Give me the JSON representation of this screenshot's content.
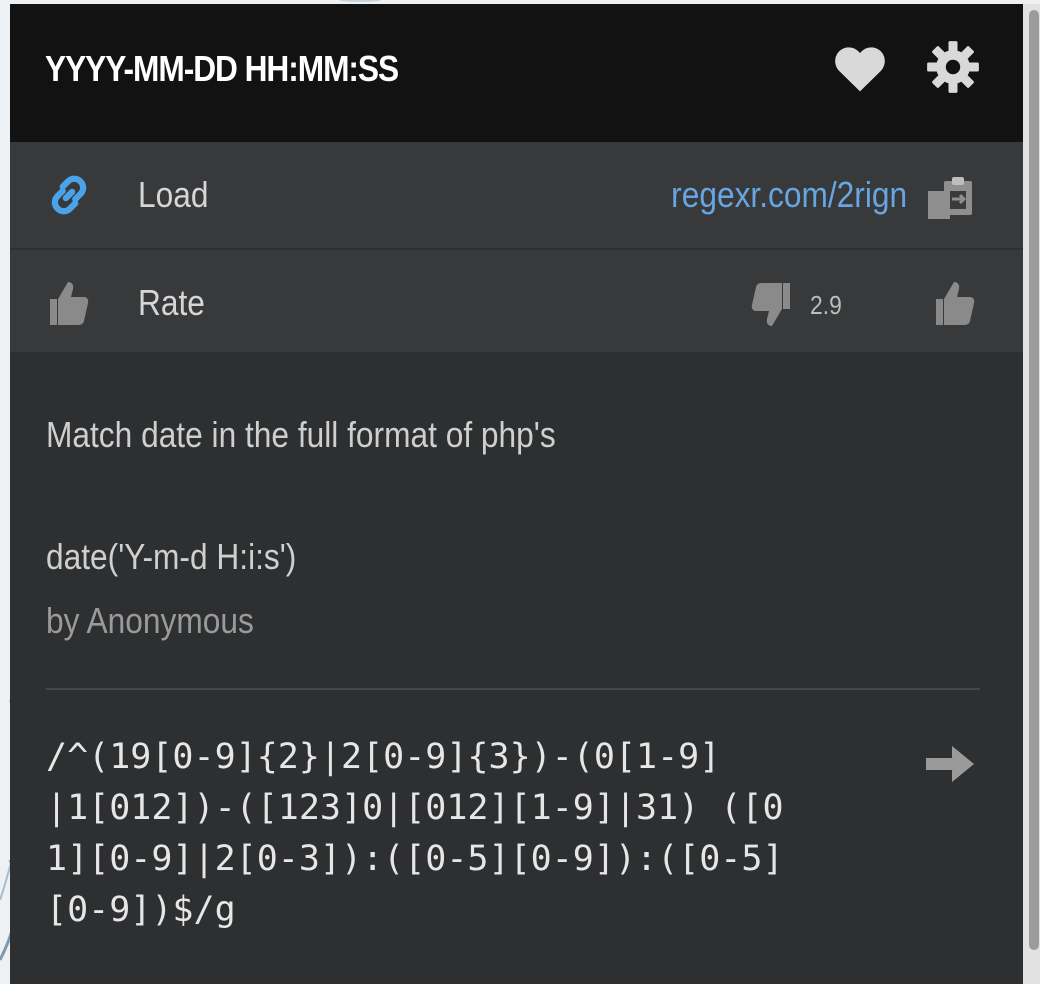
{
  "header": {
    "title": "YYYY-MM-DD HH:MM:SS",
    "favorite_icon": "heart-icon",
    "settings_icon": "gear-icon"
  },
  "load_row": {
    "icon": "link-icon",
    "label": "Load",
    "link_text": "regexr.com/2rign",
    "copy_icon": "clipboard-icon"
  },
  "rate_row": {
    "icon": "thumbs-up-icon",
    "label": "Rate",
    "rating": "2.9",
    "downvote_icon": "thumbs-down-icon",
    "upvote_icon": "thumbs-up-icon"
  },
  "description": {
    "line1": "Match date in the full format of php's",
    "line2": "date('Y-m-d H:i:s')",
    "author": "by Anonymous"
  },
  "pattern": {
    "lines": [
      "/^(19[0-9]{2}|2[0-9]{3})-(0[1-9]",
      "|1[012])-([123]0|[012][1-9]|31) ([0",
      "1][0-9]|2[0-3]):([0-5][0-9]):([0-5]",
      "[0-9])$/g"
    ],
    "load_icon": "arrow-right-icon"
  },
  "colors": {
    "header_bg": "#121212",
    "panel_bg": "#2d2f31",
    "row_bg": "#38393b",
    "link": "#67a6e0",
    "link_icon": "#4aa3e8"
  }
}
